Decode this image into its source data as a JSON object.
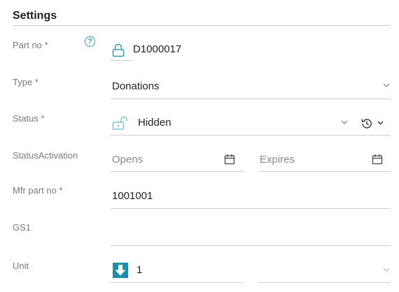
{
  "header": {
    "title": "Settings"
  },
  "fields": {
    "part_no": {
      "label": "Part no *",
      "value": "D1000017"
    },
    "type": {
      "label": "Type *",
      "value": "Donations"
    },
    "status": {
      "label": "Status *",
      "value": "Hidden"
    },
    "status_activation": {
      "label": "StatusActivation",
      "opens_placeholder": "Opens",
      "expires_placeholder": "Expires"
    },
    "mfr_part_no": {
      "label": "Mfr part no *",
      "value": "1001001"
    },
    "gs1": {
      "label": "GS1",
      "value": ""
    },
    "unit": {
      "label": "Unit",
      "value": "1",
      "second_value": ""
    }
  },
  "icons": {
    "help": "question-circle-icon",
    "lock": "lock-icon",
    "unlock": "unlock-icon",
    "history": "history-icon",
    "calendar": "calendar-icon",
    "unit": "download-arrow-icon",
    "chevron": "chevron-down-icon"
  },
  "colors": {
    "accent": "#2a9db5",
    "unit_icon_bg": "#1f8fa9"
  }
}
